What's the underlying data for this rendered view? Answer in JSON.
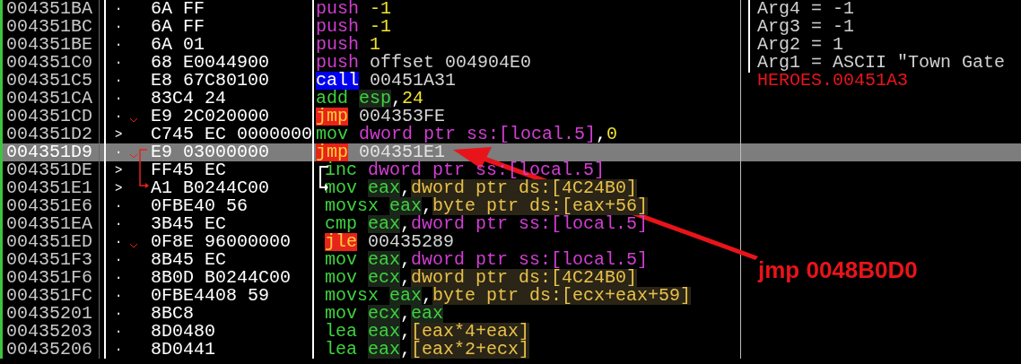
{
  "rows": [
    {
      "address": "004351BA",
      "marker": "·",
      "jump": false,
      "bytes": "6A FF",
      "mnemonic": {
        "text": "push",
        "kind": "push"
      },
      "operands": [
        {
          "text": "-1",
          "kind": "imm"
        }
      ],
      "indented": false,
      "selected": false,
      "comment": {
        "text": "Arg4 = -1",
        "kind": "arg"
      }
    },
    {
      "address": "004351BC",
      "marker": "·",
      "jump": false,
      "bytes": "6A FF",
      "mnemonic": {
        "text": "push",
        "kind": "push"
      },
      "operands": [
        {
          "text": "-1",
          "kind": "imm"
        }
      ],
      "indented": false,
      "selected": false,
      "comment": {
        "text": "Arg3 = -1",
        "kind": "arg"
      }
    },
    {
      "address": "004351BE",
      "marker": "·",
      "jump": false,
      "bytes": "6A 01",
      "mnemonic": {
        "text": "push",
        "kind": "push"
      },
      "operands": [
        {
          "text": "1",
          "kind": "imm"
        }
      ],
      "indented": false,
      "selected": false,
      "comment": {
        "text": "Arg2 = 1",
        "kind": "arg"
      }
    },
    {
      "address": "004351C0",
      "marker": "·",
      "jump": false,
      "bytes": "68 E0044900",
      "mnemonic": {
        "text": "push",
        "kind": "push"
      },
      "operands": [
        {
          "text": "offset 004904E0",
          "kind": "addr"
        }
      ],
      "indented": false,
      "selected": false,
      "comment": {
        "text": "Arg1 = ASCII \"Town Gate",
        "kind": "arg"
      }
    },
    {
      "address": "004351C5",
      "marker": "·",
      "jump": false,
      "bytes": "E8 67C80100",
      "mnemonic": {
        "text": "call",
        "kind": "call"
      },
      "operands": [
        {
          "text": "00451A31",
          "kind": "addr"
        }
      ],
      "indented": false,
      "selected": false,
      "comment": {
        "text": "HEROES.00451A3",
        "kind": "label"
      }
    },
    {
      "address": "004351CA",
      "marker": "·",
      "jump": false,
      "bytes": "83C4 24",
      "mnemonic": {
        "text": "add",
        "kind": "op"
      },
      "operands": [
        {
          "text": "esp",
          "kind": "reg"
        },
        {
          "text": ",",
          "kind": "punct"
        },
        {
          "text": "24",
          "kind": "imm"
        }
      ],
      "indented": false,
      "selected": false
    },
    {
      "address": "004351CD",
      "marker": "·",
      "jump": true,
      "bytes": "E9 2C020000",
      "mnemonic": {
        "text": "jmp",
        "kind": "jump"
      },
      "operands": [
        {
          "text": "004353FE",
          "kind": "addr"
        }
      ],
      "indented": false,
      "selected": false
    },
    {
      "address": "004351D2",
      "marker": ">",
      "jump": false,
      "bytes": "C745 EC 0000000",
      "mnemonic": {
        "text": "mov",
        "kind": "op"
      },
      "operands": [
        {
          "text": "dword ptr ss:[local.5]",
          "kind": "stack"
        },
        {
          "text": ",",
          "kind": "punct"
        },
        {
          "text": "0",
          "kind": "imm"
        }
      ],
      "indented": false,
      "selected": false
    },
    {
      "address": "004351D9",
      "marker": "·",
      "jump": true,
      "bytes": "E9 03000000",
      "mnemonic": {
        "text": "jmp",
        "kind": "jump"
      },
      "operands": [
        {
          "text": "004351E1",
          "kind": "addr"
        }
      ],
      "indented": false,
      "selected": true
    },
    {
      "address": "004351DE",
      "marker": ">",
      "jump": false,
      "bytes": "FF45 EC",
      "mnemonic": {
        "text": "inc",
        "kind": "op"
      },
      "operands": [
        {
          "text": "dword ptr ss:[local.5]",
          "kind": "stack"
        }
      ],
      "indented": true,
      "selected": false
    },
    {
      "address": "004351E1",
      "marker": ">",
      "jump": false,
      "bytes": "A1 B0244C00",
      "mnemonic": {
        "text": "mov",
        "kind": "op"
      },
      "operands": [
        {
          "text": "eax",
          "kind": "reg"
        },
        {
          "text": ",",
          "kind": "punct"
        },
        {
          "text": "dword ptr ds:[4C24B0]",
          "kind": "mem"
        }
      ],
      "indented": true,
      "selected": false
    },
    {
      "address": "004351E6",
      "marker": "·",
      "jump": false,
      "bytes": "0FBE40 56",
      "mnemonic": {
        "text": "movsx",
        "kind": "op"
      },
      "operands": [
        {
          "text": "eax",
          "kind": "reg"
        },
        {
          "text": ",",
          "kind": "punct"
        },
        {
          "text": "byte ptr ds:[eax+56]",
          "kind": "mem"
        }
      ],
      "indented": true,
      "selected": false
    },
    {
      "address": "004351EA",
      "marker": "·",
      "jump": false,
      "bytes": "3B45 EC",
      "mnemonic": {
        "text": "cmp",
        "kind": "op"
      },
      "operands": [
        {
          "text": "eax",
          "kind": "reg"
        },
        {
          "text": ",",
          "kind": "punct"
        },
        {
          "text": "dword ptr ss:[local.5]",
          "kind": "stack"
        }
      ],
      "indented": true,
      "selected": false
    },
    {
      "address": "004351ED",
      "marker": "·",
      "jump": true,
      "bytes": "0F8E 96000000",
      "mnemonic": {
        "text": "jle",
        "kind": "jump"
      },
      "operands": [
        {
          "text": "00435289",
          "kind": "addr"
        }
      ],
      "indented": true,
      "selected": false
    },
    {
      "address": "004351F3",
      "marker": "·",
      "jump": false,
      "bytes": "8B45 EC",
      "mnemonic": {
        "text": "mov",
        "kind": "op"
      },
      "operands": [
        {
          "text": "eax",
          "kind": "reg"
        },
        {
          "text": ",",
          "kind": "punct"
        },
        {
          "text": "dword ptr ss:[local.5]",
          "kind": "stack"
        }
      ],
      "indented": true,
      "selected": false
    },
    {
      "address": "004351F6",
      "marker": "·",
      "jump": false,
      "bytes": "8B0D B0244C00",
      "mnemonic": {
        "text": "mov",
        "kind": "op"
      },
      "operands": [
        {
          "text": "ecx",
          "kind": "reg"
        },
        {
          "text": ",",
          "kind": "punct"
        },
        {
          "text": "dword ptr ds:[4C24B0]",
          "kind": "mem"
        }
      ],
      "indented": true,
      "selected": false
    },
    {
      "address": "004351FC",
      "marker": "·",
      "jump": false,
      "bytes": "0FBE4408 59",
      "mnemonic": {
        "text": "movsx",
        "kind": "op"
      },
      "operands": [
        {
          "text": "eax",
          "kind": "reg"
        },
        {
          "text": ",",
          "kind": "punct"
        },
        {
          "text": "byte ptr ds:[ecx+eax+59]",
          "kind": "mem"
        }
      ],
      "indented": true,
      "selected": false
    },
    {
      "address": "00435201",
      "marker": "·",
      "jump": false,
      "bytes": "8BC8",
      "mnemonic": {
        "text": "mov",
        "kind": "op"
      },
      "operands": [
        {
          "text": "ecx",
          "kind": "reg"
        },
        {
          "text": ",",
          "kind": "punct"
        },
        {
          "text": "eax",
          "kind": "reg"
        }
      ],
      "indented": true,
      "selected": false
    },
    {
      "address": "00435203",
      "marker": "·",
      "jump": false,
      "bytes": "8D0480",
      "mnemonic": {
        "text": "lea",
        "kind": "op"
      },
      "operands": [
        {
          "text": "eax",
          "kind": "reg"
        },
        {
          "text": ",",
          "kind": "punct"
        },
        {
          "text": "[eax*4+eax]",
          "kind": "mem"
        }
      ],
      "indented": true,
      "selected": false
    },
    {
      "address": "00435206",
      "marker": "·",
      "jump": false,
      "bytes": "8D0441",
      "mnemonic": {
        "text": "lea",
        "kind": "op"
      },
      "operands": [
        {
          "text": "eax",
          "kind": "reg"
        },
        {
          "text": ",",
          "kind": "punct"
        },
        {
          "text": "[eax*2+ecx]",
          "kind": "mem"
        }
      ],
      "indented": true,
      "selected": false
    }
  ],
  "annotation": {
    "text": "jmp 0048B0D0"
  }
}
